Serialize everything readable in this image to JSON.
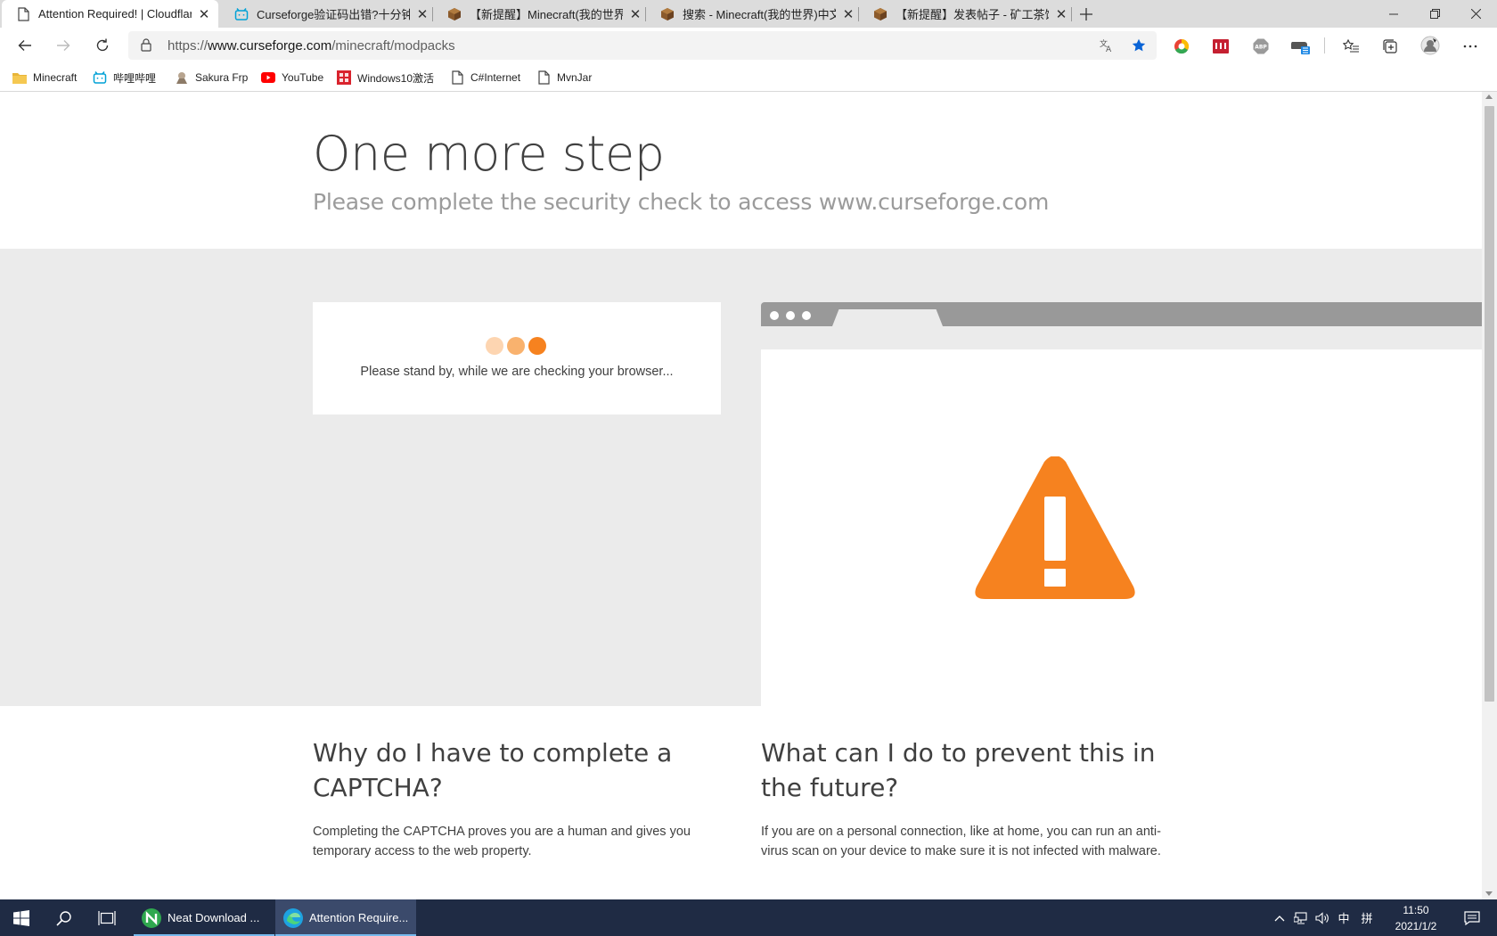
{
  "browser": {
    "tabs": [
      {
        "title": "Attention Required! | Cloudflare",
        "active": true,
        "icon": "page-icon"
      },
      {
        "title": "Curseforge验证码出错?十分钟解决",
        "active": false,
        "icon": "bilibili-icon"
      },
      {
        "title": "【新提醒】Minecraft(我的世界)中文",
        "active": false,
        "icon": "minecraft-block-icon"
      },
      {
        "title": "搜索 - Minecraft(我的世界)中文论坛",
        "active": false,
        "icon": "minecraft-block-icon"
      },
      {
        "title": "【新提醒】发表帖子 - 矿工茶馆",
        "active": false,
        "icon": "minecraft-block-icon"
      }
    ],
    "url_prefix": "https://",
    "url_host": "www.curseforge.com",
    "url_path": "/minecraft/modpacks",
    "bookmarks": [
      {
        "label": "Minecraft",
        "icon": "folder-icon"
      },
      {
        "label": "哔哩哔哩",
        "icon": "bilibili-icon"
      },
      {
        "label": "Sakura Frp",
        "icon": "sakura-icon"
      },
      {
        "label": "YouTube",
        "icon": "youtube-icon"
      },
      {
        "label": "Windows10激活",
        "icon": "red-site-icon"
      },
      {
        "label": "C#Internet",
        "icon": "page-icon"
      },
      {
        "label": "MvnJar",
        "icon": "page-icon"
      }
    ],
    "extensions": [
      "chrome-circle-icon",
      "red-extension-icon",
      "abp-icon",
      "gamepad-extension-icon"
    ],
    "abp_label": "ABP"
  },
  "page": {
    "title": "One more step",
    "subtitle": "Please complete the security check to access www.curseforge.com",
    "status_message": "Please stand by, while we are checking your browser...",
    "dot_colors": [
      "#fdd5b1",
      "#f9b26e",
      "#f6821f"
    ],
    "accent_color": "#f6821f",
    "why_heading": "Why do I have to complete a CAPTCHA?",
    "why_text": "Completing the CAPTCHA proves you are a human and gives you temporary access to the web property.",
    "prevent_heading": "What can I do to prevent this in the future?",
    "prevent_text": "If you are on a personal connection, like at home, you can run an anti-virus scan on your device to make sure it is not infected with malware."
  },
  "taskbar": {
    "tasks": [
      {
        "label": "Neat Download ...",
        "icon": "neat-download-icon",
        "active": false
      },
      {
        "label": "Attention Require...",
        "icon": "edge-icon",
        "active": true
      }
    ],
    "ime": "中",
    "ime_mode": "拼",
    "time": "11:50",
    "date": "2021/1/2"
  }
}
